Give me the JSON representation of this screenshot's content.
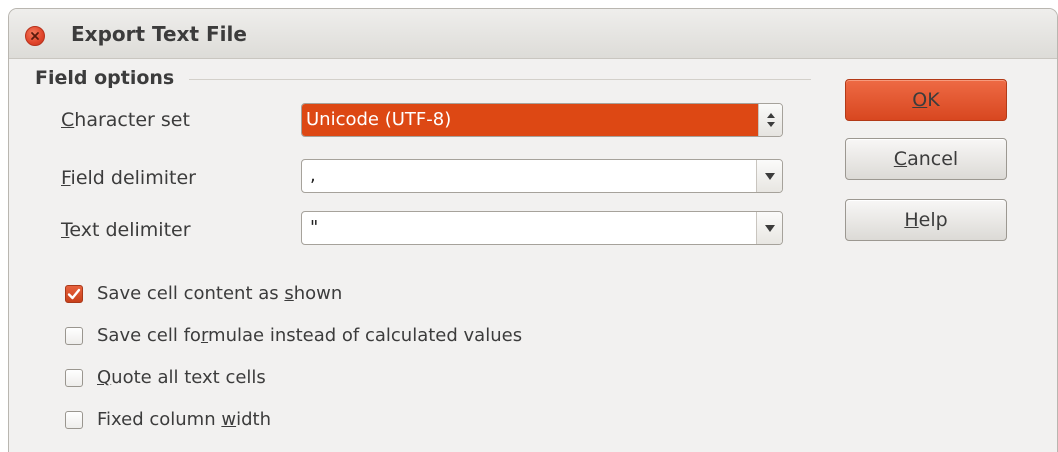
{
  "window": {
    "title": "Export Text File"
  },
  "field_options": {
    "section_label": "Field options",
    "character_set": {
      "label_mnemonic": "C",
      "label_rest": "haracter set",
      "value": "Unicode (UTF-8)"
    },
    "field_delimiter": {
      "label_mnemonic": "F",
      "label_rest": "ield delimiter",
      "value": ","
    },
    "text_delimiter": {
      "label_mnemonic": "T",
      "label_rest": "ext delimiter",
      "value": "\""
    }
  },
  "checkboxes": [
    {
      "pre": "Save cell content as ",
      "mnemonic": "s",
      "post": "hown",
      "checked": true
    },
    {
      "pre": "Save cell fo",
      "mnemonic": "r",
      "post": "mulae instead of calculated values",
      "checked": false
    },
    {
      "pre": "",
      "mnemonic": "Q",
      "post": "uote all text cells",
      "checked": false
    },
    {
      "pre": "Fixed column ",
      "mnemonic": "w",
      "post": "idth",
      "checked": false
    }
  ],
  "buttons": {
    "ok": {
      "mnemonic": "O",
      "rest": "K"
    },
    "cancel": {
      "mnemonic": "C",
      "rest": "ancel"
    },
    "help": {
      "mnemonic": "H",
      "rest": "elp"
    }
  },
  "colors": {
    "accent": "#dd4814",
    "window_bg": "#f2f1f0"
  },
  "icons": {
    "close": "close-icon",
    "spin": "spin-arrows-icon",
    "dropdown": "chevron-down-icon",
    "check": "checkmark-icon"
  }
}
